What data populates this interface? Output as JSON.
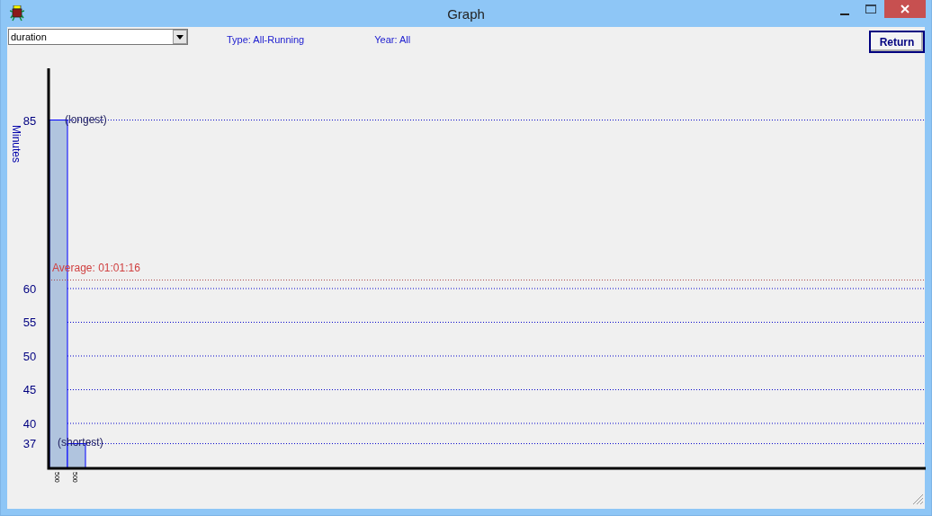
{
  "window": {
    "title": "Graph"
  },
  "toolbar": {
    "field": {
      "value": "duration"
    },
    "type_label": "Type: All-Running",
    "year_label": "Year: All",
    "return_button": "Return"
  },
  "graph": {
    "chart_data": {
      "type": "bar",
      "ylabel": "Minutes",
      "categories": [
        "500",
        "500"
      ],
      "values": [
        85,
        37
      ],
      "ylim": [
        33.33,
        92.67
      ],
      "yticks": [
        37,
        40,
        45,
        50,
        55,
        60,
        85
      ],
      "grid": true,
      "ref_lines": [
        {
          "axis": "y",
          "value": 61.2667,
          "color": "#aa4444"
        }
      ],
      "annotations": [
        "(longest)",
        "(shortest)",
        "Average: 01:01:16"
      ]
    }
  }
}
